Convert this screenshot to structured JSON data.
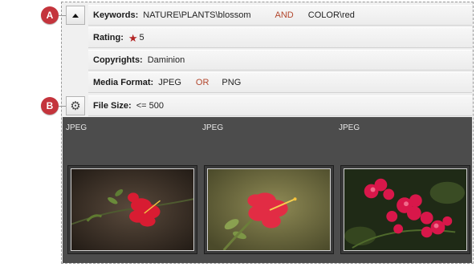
{
  "callouts": {
    "a": "A",
    "b": "B"
  },
  "filters": {
    "keywords": {
      "label": "Keywords:",
      "value1": "NATURE\\PLANTS\\blossom",
      "operator": "AND",
      "value2": "COLOR\\red"
    },
    "rating": {
      "label": "Rating:",
      "value": "5"
    },
    "copyrights": {
      "label": "Copyrights:",
      "value": "Daminion"
    },
    "media_format": {
      "label": "Media Format:",
      "value1": "JPEG",
      "operator": "OR",
      "value2": "PNG"
    },
    "file_size": {
      "label": "File Size:",
      "value": "<= 500"
    }
  },
  "thumbnails": [
    {
      "format": "JPEG",
      "subject": "red hibiscus flower on dark background"
    },
    {
      "format": "JPEG",
      "subject": "red hibiscus flower on green background"
    },
    {
      "format": "JPEG",
      "subject": "red bougainvillea flowers"
    }
  ],
  "icons": {
    "collapse": "chevron-up-icon",
    "settings": "gear-icon",
    "rating": "star-icon"
  },
  "colors": {
    "callout": "#c4343c",
    "operator": "#b2462c",
    "star": "#b32424",
    "grid_bg": "#4c4c4c"
  }
}
